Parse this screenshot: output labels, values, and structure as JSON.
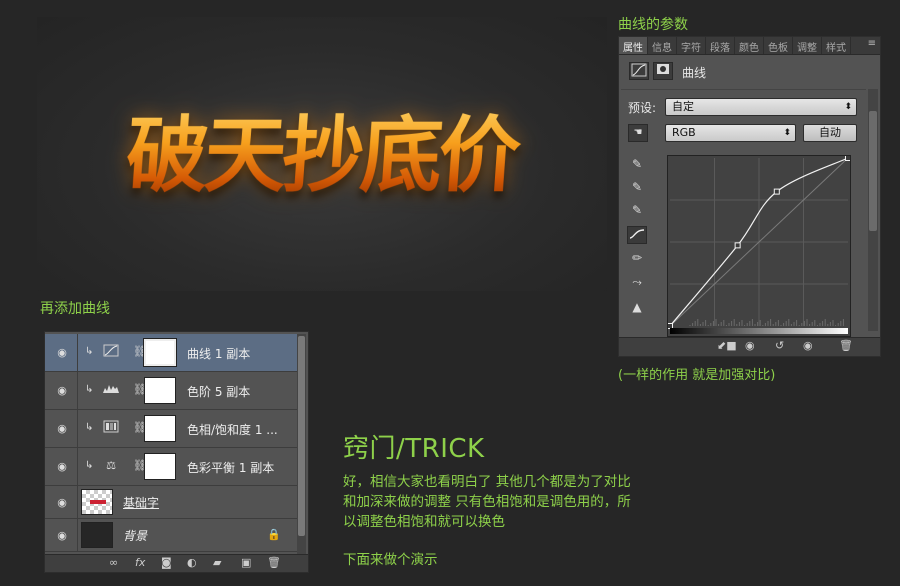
{
  "preview": {
    "title_text": "破天抄底价"
  },
  "properties_panel": {
    "caption": "曲线的参数",
    "tabs": [
      "属性",
      "信息",
      "字符",
      "段落",
      "颜色",
      "色板",
      "调整",
      "样式"
    ],
    "menu_icon": "≡",
    "header_label": "曲线",
    "preset_label": "预设:",
    "preset_value": "自定",
    "channel_value": "RGB",
    "auto_button": "自动",
    "curve_points": [
      [
        0.0,
        0.0
      ],
      [
        0.38,
        0.48
      ],
      [
        0.6,
        0.8
      ],
      [
        1.0,
        1.0
      ]
    ],
    "bottom_caption": "(一样的作用 就是加强对比)"
  },
  "layers_panel": {
    "caption": "再添加曲线",
    "rows": [
      {
        "name": "曲线 1 副本",
        "type": "adjustment",
        "icon": "curves-icon",
        "selected": true
      },
      {
        "name": "色阶 5 副本",
        "type": "adjustment",
        "icon": "levels-icon",
        "selected": false
      },
      {
        "name": "色相/饱和度 1 ...",
        "type": "adjustment",
        "icon": "hue-saturation-icon",
        "selected": false
      },
      {
        "name": "色彩平衡 1 副本",
        "type": "adjustment",
        "icon": "color-balance-icon",
        "selected": false
      },
      {
        "name": "基础字",
        "type": "text-layer",
        "selected": false
      },
      {
        "name": "背景",
        "type": "background",
        "locked": true,
        "selected": false
      }
    ],
    "footer_icons": [
      "link-icon",
      "fx-icon",
      "mask-icon",
      "adjustment-icon",
      "folder-icon",
      "new-layer-icon",
      "trash-icon"
    ]
  },
  "trick": {
    "title": "窍门/TRICK",
    "lines": [
      "好，相信大家也看明白了 其他几个都是为了对比",
      "和加深来做的调整 只有色相饱和是调色用的，所",
      "以调整色相饱和就可以换色"
    ],
    "demo_line": "下面来做个演示"
  },
  "colors": {
    "accent": "#8ed14a",
    "panel": "#535353",
    "background": "#262626",
    "selection": "#5c6d84"
  }
}
